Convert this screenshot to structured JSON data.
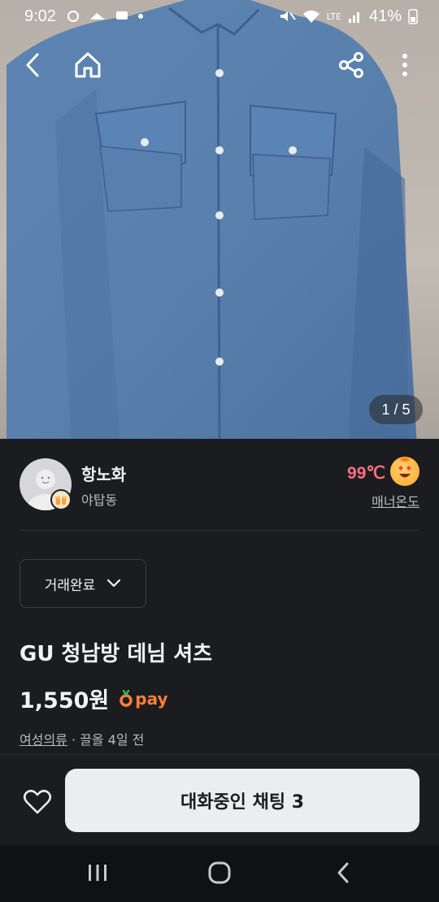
{
  "status_bar": {
    "time": "9:02",
    "battery": "41%",
    "network": "LTE"
  },
  "image_viewer": {
    "counter": "1 / 5"
  },
  "seller": {
    "nickname": "항노화",
    "region": "야탑동",
    "manner_temp": "99℃",
    "manner_label": "매너온도"
  },
  "trade_status": {
    "label": "거래완료"
  },
  "product": {
    "title": "GU 청남방 데님 셔츠",
    "price": "1,550원",
    "pay_label": "pay",
    "category": "여성의류",
    "separator": " · ",
    "time_info": "끌올 4일 전"
  },
  "bottom_bar": {
    "chat_button": "대화중인 채팅 3"
  },
  "colors": {
    "background": "#1b1c1f",
    "accent_pay": "#ff7e36",
    "manner_temp": "#ff6e7f",
    "chat_button_bg": "#ecedf0"
  },
  "icons": {
    "back": "arrow-left-icon",
    "home": "home-icon",
    "share": "share-icon",
    "more": "more-vertical-icon",
    "like": "heart-icon",
    "dropdown": "chevron-down-icon",
    "sys_recents": "recents-icon",
    "sys_home": "home-circle-icon",
    "sys_back": "chevron-left-icon"
  }
}
